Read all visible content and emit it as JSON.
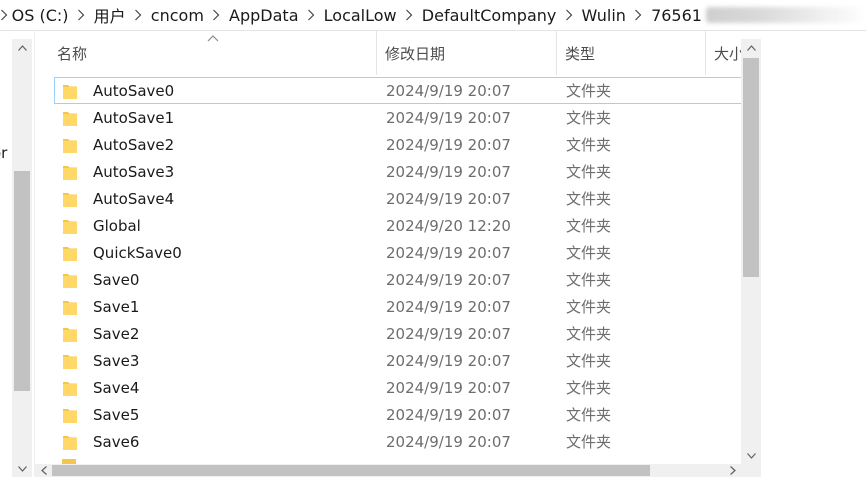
{
  "breadcrumb": {
    "items": [
      "OS (C:)",
      "用户",
      "cncom",
      "AppData",
      "LocalLow",
      "DefaultCompany",
      "Wulin"
    ],
    "last_partial": "76561"
  },
  "nav_pane": {
    "fragment_text": "or"
  },
  "columns": {
    "name": "名称",
    "date": "修改日期",
    "type": "类型",
    "size": "大小"
  },
  "files": [
    {
      "name": "AutoSave0",
      "date": "2024/9/19 20:07",
      "type": "文件夹"
    },
    {
      "name": "AutoSave1",
      "date": "2024/9/19 20:07",
      "type": "文件夹"
    },
    {
      "name": "AutoSave2",
      "date": "2024/9/19 20:07",
      "type": "文件夹"
    },
    {
      "name": "AutoSave3",
      "date": "2024/9/19 20:07",
      "type": "文件夹"
    },
    {
      "name": "AutoSave4",
      "date": "2024/9/19 20:07",
      "type": "文件夹"
    },
    {
      "name": "Global",
      "date": "2024/9/20 12:20",
      "type": "文件夹"
    },
    {
      "name": "QuickSave0",
      "date": "2024/9/19 20:07",
      "type": "文件夹"
    },
    {
      "name": "Save0",
      "date": "2024/9/19 20:07",
      "type": "文件夹"
    },
    {
      "name": "Save1",
      "date": "2024/9/19 20:07",
      "type": "文件夹"
    },
    {
      "name": "Save2",
      "date": "2024/9/19 20:07",
      "type": "文件夹"
    },
    {
      "name": "Save3",
      "date": "2024/9/19 20:07",
      "type": "文件夹"
    },
    {
      "name": "Save4",
      "date": "2024/9/19 20:07",
      "type": "文件夹"
    },
    {
      "name": "Save5",
      "date": "2024/9/19 20:07",
      "type": "文件夹"
    },
    {
      "name": "Save6",
      "date": "2024/9/19 20:07",
      "type": "文件夹"
    }
  ],
  "icons": {
    "folder": "folder-icon",
    "breadcrumb_separator": "chevron-right-icon",
    "sort_indicator": "sort-ascending-icon"
  },
  "colors": {
    "folder_yellow": "#f5c64e",
    "focus_border": "#99d1ff",
    "scrollbar_track": "#f0f0f0",
    "scrollbar_thumb": "#c2c2c2"
  }
}
